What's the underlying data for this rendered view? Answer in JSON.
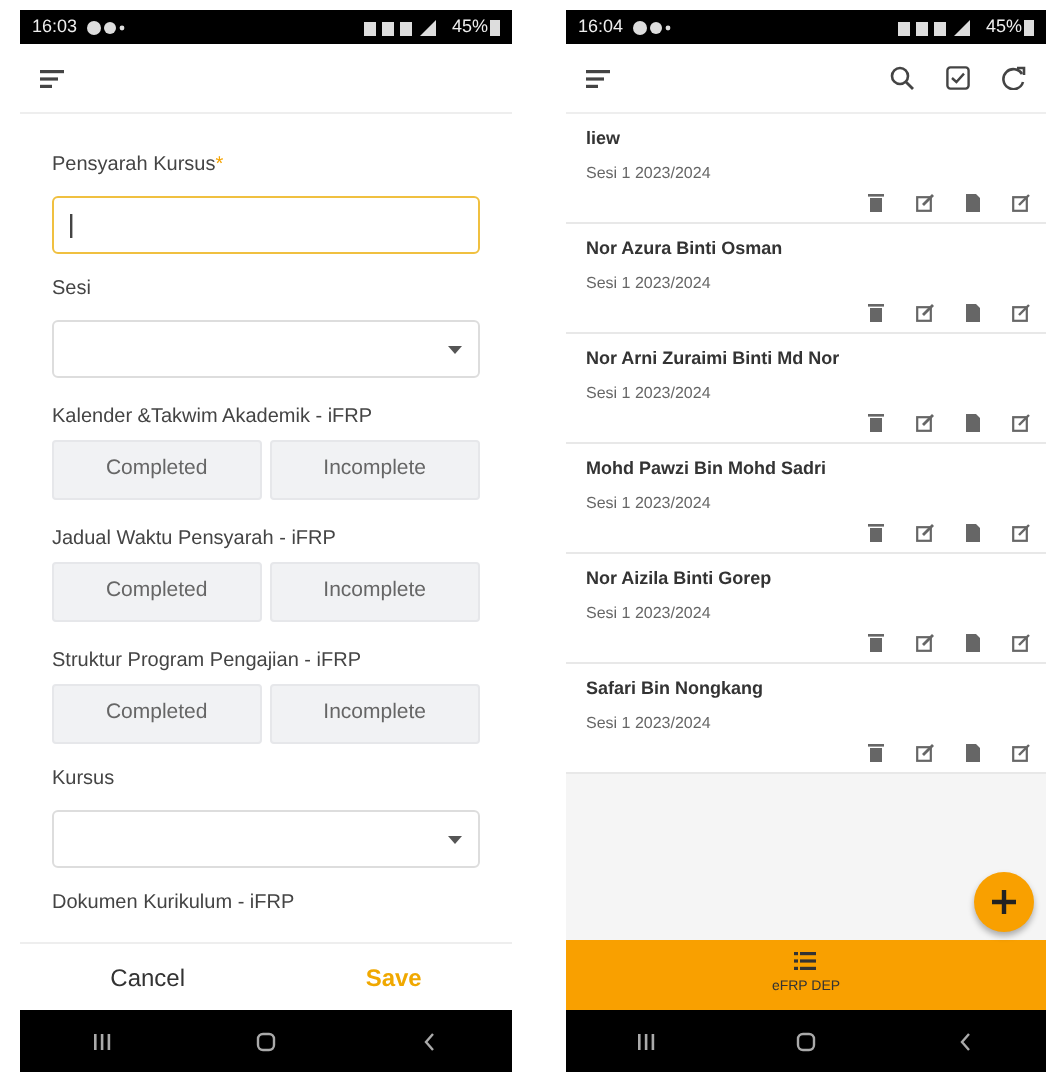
{
  "form_screen": {
    "status_bar": {
      "time": "16:03",
      "battery": "45%"
    },
    "fields": [
      {
        "kind": "text",
        "label": "Pensyarah Kursus",
        "required_mark": "*",
        "focused": true
      },
      {
        "kind": "select",
        "label": "Sesi",
        "focused": false
      },
      {
        "kind": "toggle",
        "label": "Kalender &Takwim Akademik - iFRP",
        "options": [
          {
            "label": "Completed",
            "selected": false
          },
          {
            "label": "Incomplete",
            "selected": false
          }
        ]
      },
      {
        "kind": "toggle",
        "label": "Jadual Waktu Pensyarah - iFRP",
        "options": [
          {
            "label": "Completed",
            "selected": false
          },
          {
            "label": "Incomplete",
            "selected": false
          }
        ]
      },
      {
        "kind": "toggle",
        "label": "Struktur Program Pengajian - iFRP",
        "options": [
          {
            "label": "Completed",
            "selected": false
          },
          {
            "label": "Incomplete",
            "selected": false
          }
        ]
      },
      {
        "kind": "select",
        "label": "Kursus",
        "focused": false
      },
      {
        "kind": "heading",
        "label": "Dokumen Kurikulum - iFRP"
      }
    ],
    "actions": [
      {
        "label": "Cancel",
        "kind": "cancel"
      },
      {
        "label": "Save",
        "kind": "save"
      }
    ]
  },
  "list_screen": {
    "status_bar": {
      "time": "16:04",
      "battery": "45%"
    },
    "items": [
      {
        "name": "liew",
        "session": "Sesi 1 2023/2024"
      },
      {
        "name": "Nor Azura Binti Osman",
        "session": "Sesi 1 2023/2024"
      },
      {
        "name": "Nor Arni Zuraimi Binti Md Nor",
        "session": "Sesi 1 2023/2024"
      },
      {
        "name": "Mohd Pawzi Bin Mohd Sadri",
        "session": "Sesi 1 2023/2024"
      },
      {
        "name": "Nor Aizila Binti Gorep",
        "session": "Sesi 1 2023/2024"
      },
      {
        "name": "Safari Bin Nongkang",
        "session": "Sesi 1 2023/2024"
      }
    ],
    "bottom_nav": [
      {
        "label": "eFRP DEP",
        "selected": true
      }
    ]
  }
}
